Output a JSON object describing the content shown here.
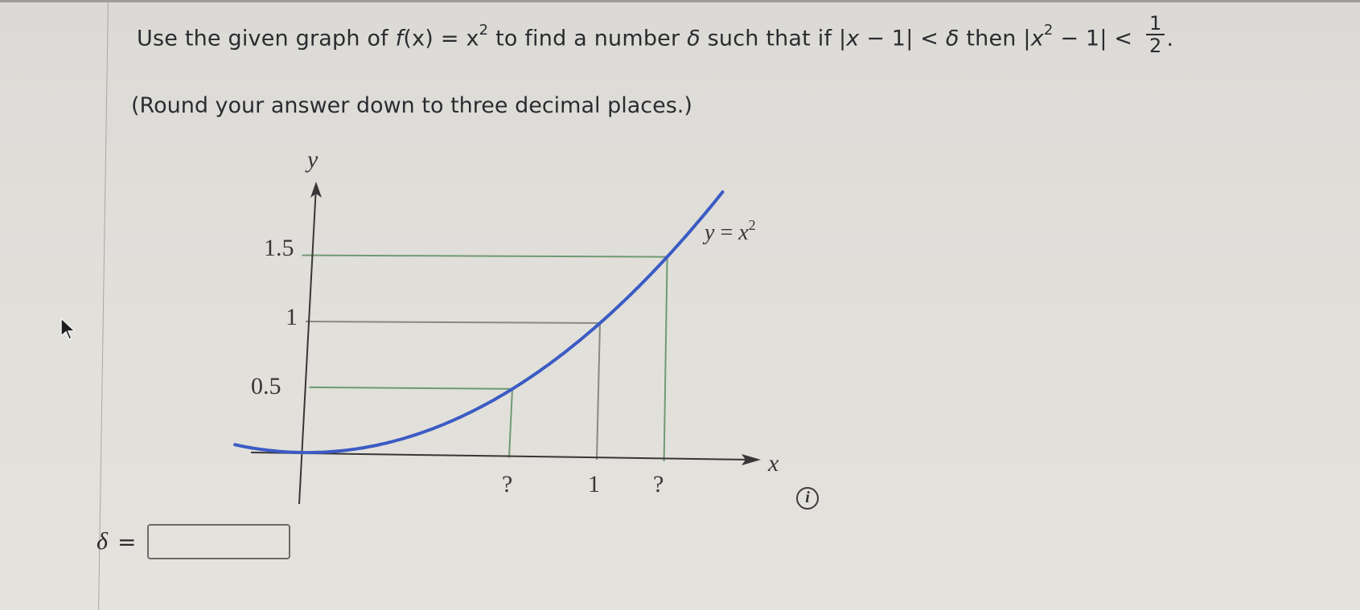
{
  "question": {
    "prefix": "Use the given graph of ",
    "func_name": "f",
    "func_arg": "(x)",
    "equals": " = ",
    "base": "x",
    "exponent": "2",
    "middle": " to find a number ",
    "delta": "δ",
    "such_that": " such that if ",
    "cond1_open": "|",
    "cond1_var": "x",
    "cond1_rest": " − 1| < ",
    "then": " then ",
    "cond2_open": "|",
    "cond2_var": "x",
    "cond2_exp": "2",
    "cond2_rest": " − 1| < ",
    "frac_num": "1",
    "frac_den": "2",
    "period": "."
  },
  "round_note": "(Round your answer down to three decimal places.)",
  "graph": {
    "y_axis_label": "y",
    "x_axis_label": "x",
    "curve_label_lhs": "y",
    "curve_label_eq": " = ",
    "curve_label_rhs": "x",
    "curve_label_exp": "2",
    "y_ticks": [
      "1.5",
      "1",
      "0.5"
    ],
    "x_ticks": [
      "?",
      "1",
      "?"
    ],
    "function": "x^2",
    "y_guide_values": [
      1.5,
      1,
      0.5
    ],
    "x_guide_values": [
      0.7071,
      1,
      1.2247
    ],
    "curve_color": "#3b5bc4",
    "guide_green": "#6f9a74",
    "guide_gray": "#8a8785",
    "axis_color": "#3a3536"
  },
  "answer": {
    "label": "δ",
    "equals": "=",
    "value": "",
    "placeholder": ""
  },
  "info_icon": {
    "glyph": "i"
  }
}
